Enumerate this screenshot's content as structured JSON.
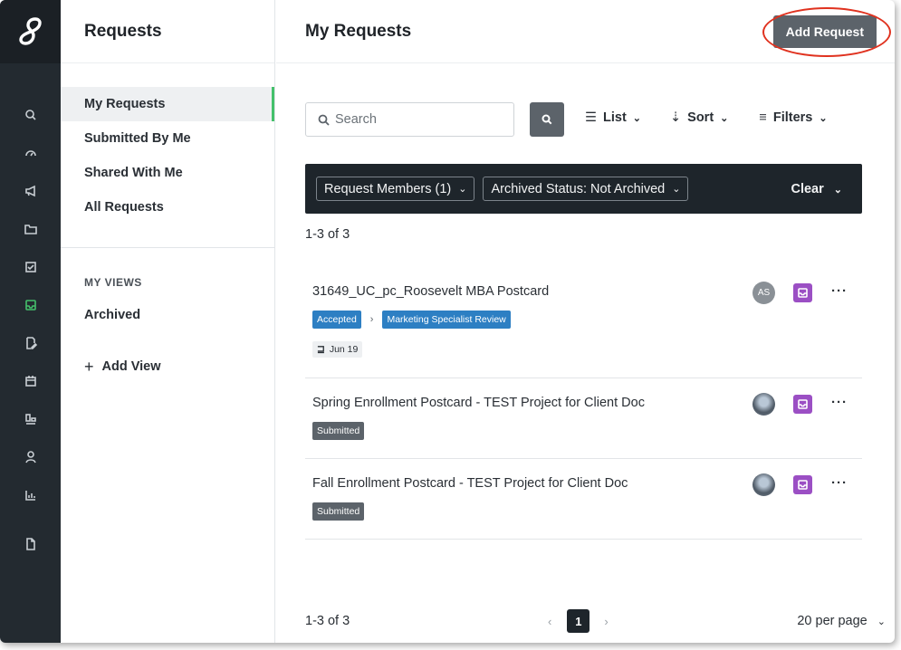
{
  "rail": {
    "icons": [
      "search-icon",
      "dashboard-icon",
      "megaphone-icon",
      "folder-icon",
      "checklist-icon",
      "inbox-icon",
      "edit-doc-icon",
      "calendar-icon",
      "org-chart-icon",
      "user-icon",
      "bar-chart-icon",
      "document-icon"
    ],
    "active": "inbox-icon",
    "accent": "#44c06b"
  },
  "nav": {
    "title": "Requests",
    "items": [
      {
        "label": "My Requests"
      },
      {
        "label": "Submitted By Me"
      },
      {
        "label": "Shared With Me"
      },
      {
        "label": "All Requests"
      }
    ],
    "views_heading": "MY VIEWS",
    "views": [
      {
        "label": "Archived"
      }
    ],
    "add_view": "Add View"
  },
  "header": {
    "title": "My Requests",
    "add_button": "Add Request"
  },
  "toolbar": {
    "search_placeholder": "Search",
    "list_label": "List",
    "sort_label": "Sort",
    "filters_label": "Filters"
  },
  "filters": {
    "chips": [
      "Request Members (1)",
      "Archived Status: Not Archived"
    ],
    "clear_label": "Clear"
  },
  "results": {
    "count_top": "1-3 of 3",
    "rows": [
      {
        "title": "31649_UC_pc_Roosevelt MBA Postcard",
        "status": "Accepted",
        "stage": "Marketing Specialist Review",
        "date": "Jun 19",
        "avatar": "AS"
      },
      {
        "title": "Spring Enrollment Postcard - TEST Project for Client Doc",
        "status": "Submitted"
      },
      {
        "title": "Fall Enrollment Postcard - TEST Project for Client Doc",
        "status": "Submitted"
      }
    ]
  },
  "footer": {
    "count": "1-3 of 3",
    "current_page": "1",
    "per_page": "20 per page"
  },
  "colors": {
    "tag_blue": "#2d7fc3",
    "tag_gray": "#5c636a",
    "inbox_badge": "#9b4fc4",
    "highlight_circle": "#e0321f"
  }
}
